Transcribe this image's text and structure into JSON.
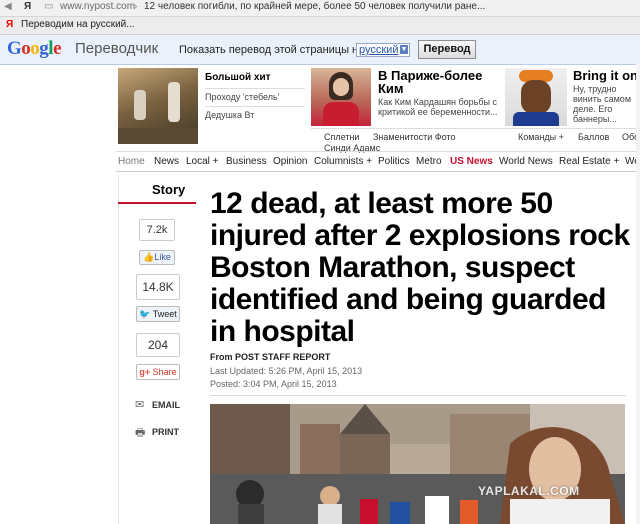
{
  "browser": {
    "address_text": "www.nypost.com",
    "page_title": "12 человек погибли, по крайней мере, более 50 человек получили ране...",
    "back_label": "Я",
    "translation_notice": "Переводим на русский..."
  },
  "translate_bar": {
    "logo_google": "Google",
    "logo_translate": "Переводчик",
    "prompt": "Показать перевод этой страницы на",
    "language": "русский",
    "button_label": "Перевод"
  },
  "promos": {
    "left_links": [
      "Большой хит",
      "Проходу 'стебель'",
      "Дедушка Вт"
    ],
    "middle": {
      "title": "В Париже-более Ким",
      "text": "Как Ким Кардашян борьбы с критикой ее беременности...",
      "links": [
        "Сплетни",
        "Знаменитости Фото",
        "Синди Адамс"
      ]
    },
    "right": {
      "title": "Bring it on",
      "text": "Ну, трудно винить самом деле. Его баннеры...",
      "links": [
        "Команды +",
        "Баллов",
        "Обо"
      ]
    }
  },
  "nav": {
    "items": [
      "Home",
      "News",
      "Local +",
      "Business",
      "Opinion",
      "Columnists +",
      "Politics",
      "Metro",
      "US News",
      "World News",
      "Real Estate +",
      "We"
    ]
  },
  "sidebar": {
    "story_label": "Story",
    "like_count": "7.2k",
    "like_label": "Like",
    "tweet_count": "14.8K",
    "tweet_label": "Tweet",
    "share_count": "204",
    "share_label": "Share",
    "email_label": "EMAIL",
    "print_label": "PRINT"
  },
  "article": {
    "headline": "12 dead, at least more 50 injured after 2 explosions rock Boston Marathon, suspect identified and being guarded in hospital",
    "byline": "From POST STAFF REPORT",
    "last_updated": "Last Updated: 5:26 PM, April 15, 2013",
    "posted": "Posted: 3:04 PM, April 15, 2013"
  },
  "watermark": "YAPLAKAL.COM",
  "colors": {
    "accent_red": "#c8102e",
    "translate_bar_bg": "#eaf1fb",
    "link_blue": "#2255aa"
  }
}
